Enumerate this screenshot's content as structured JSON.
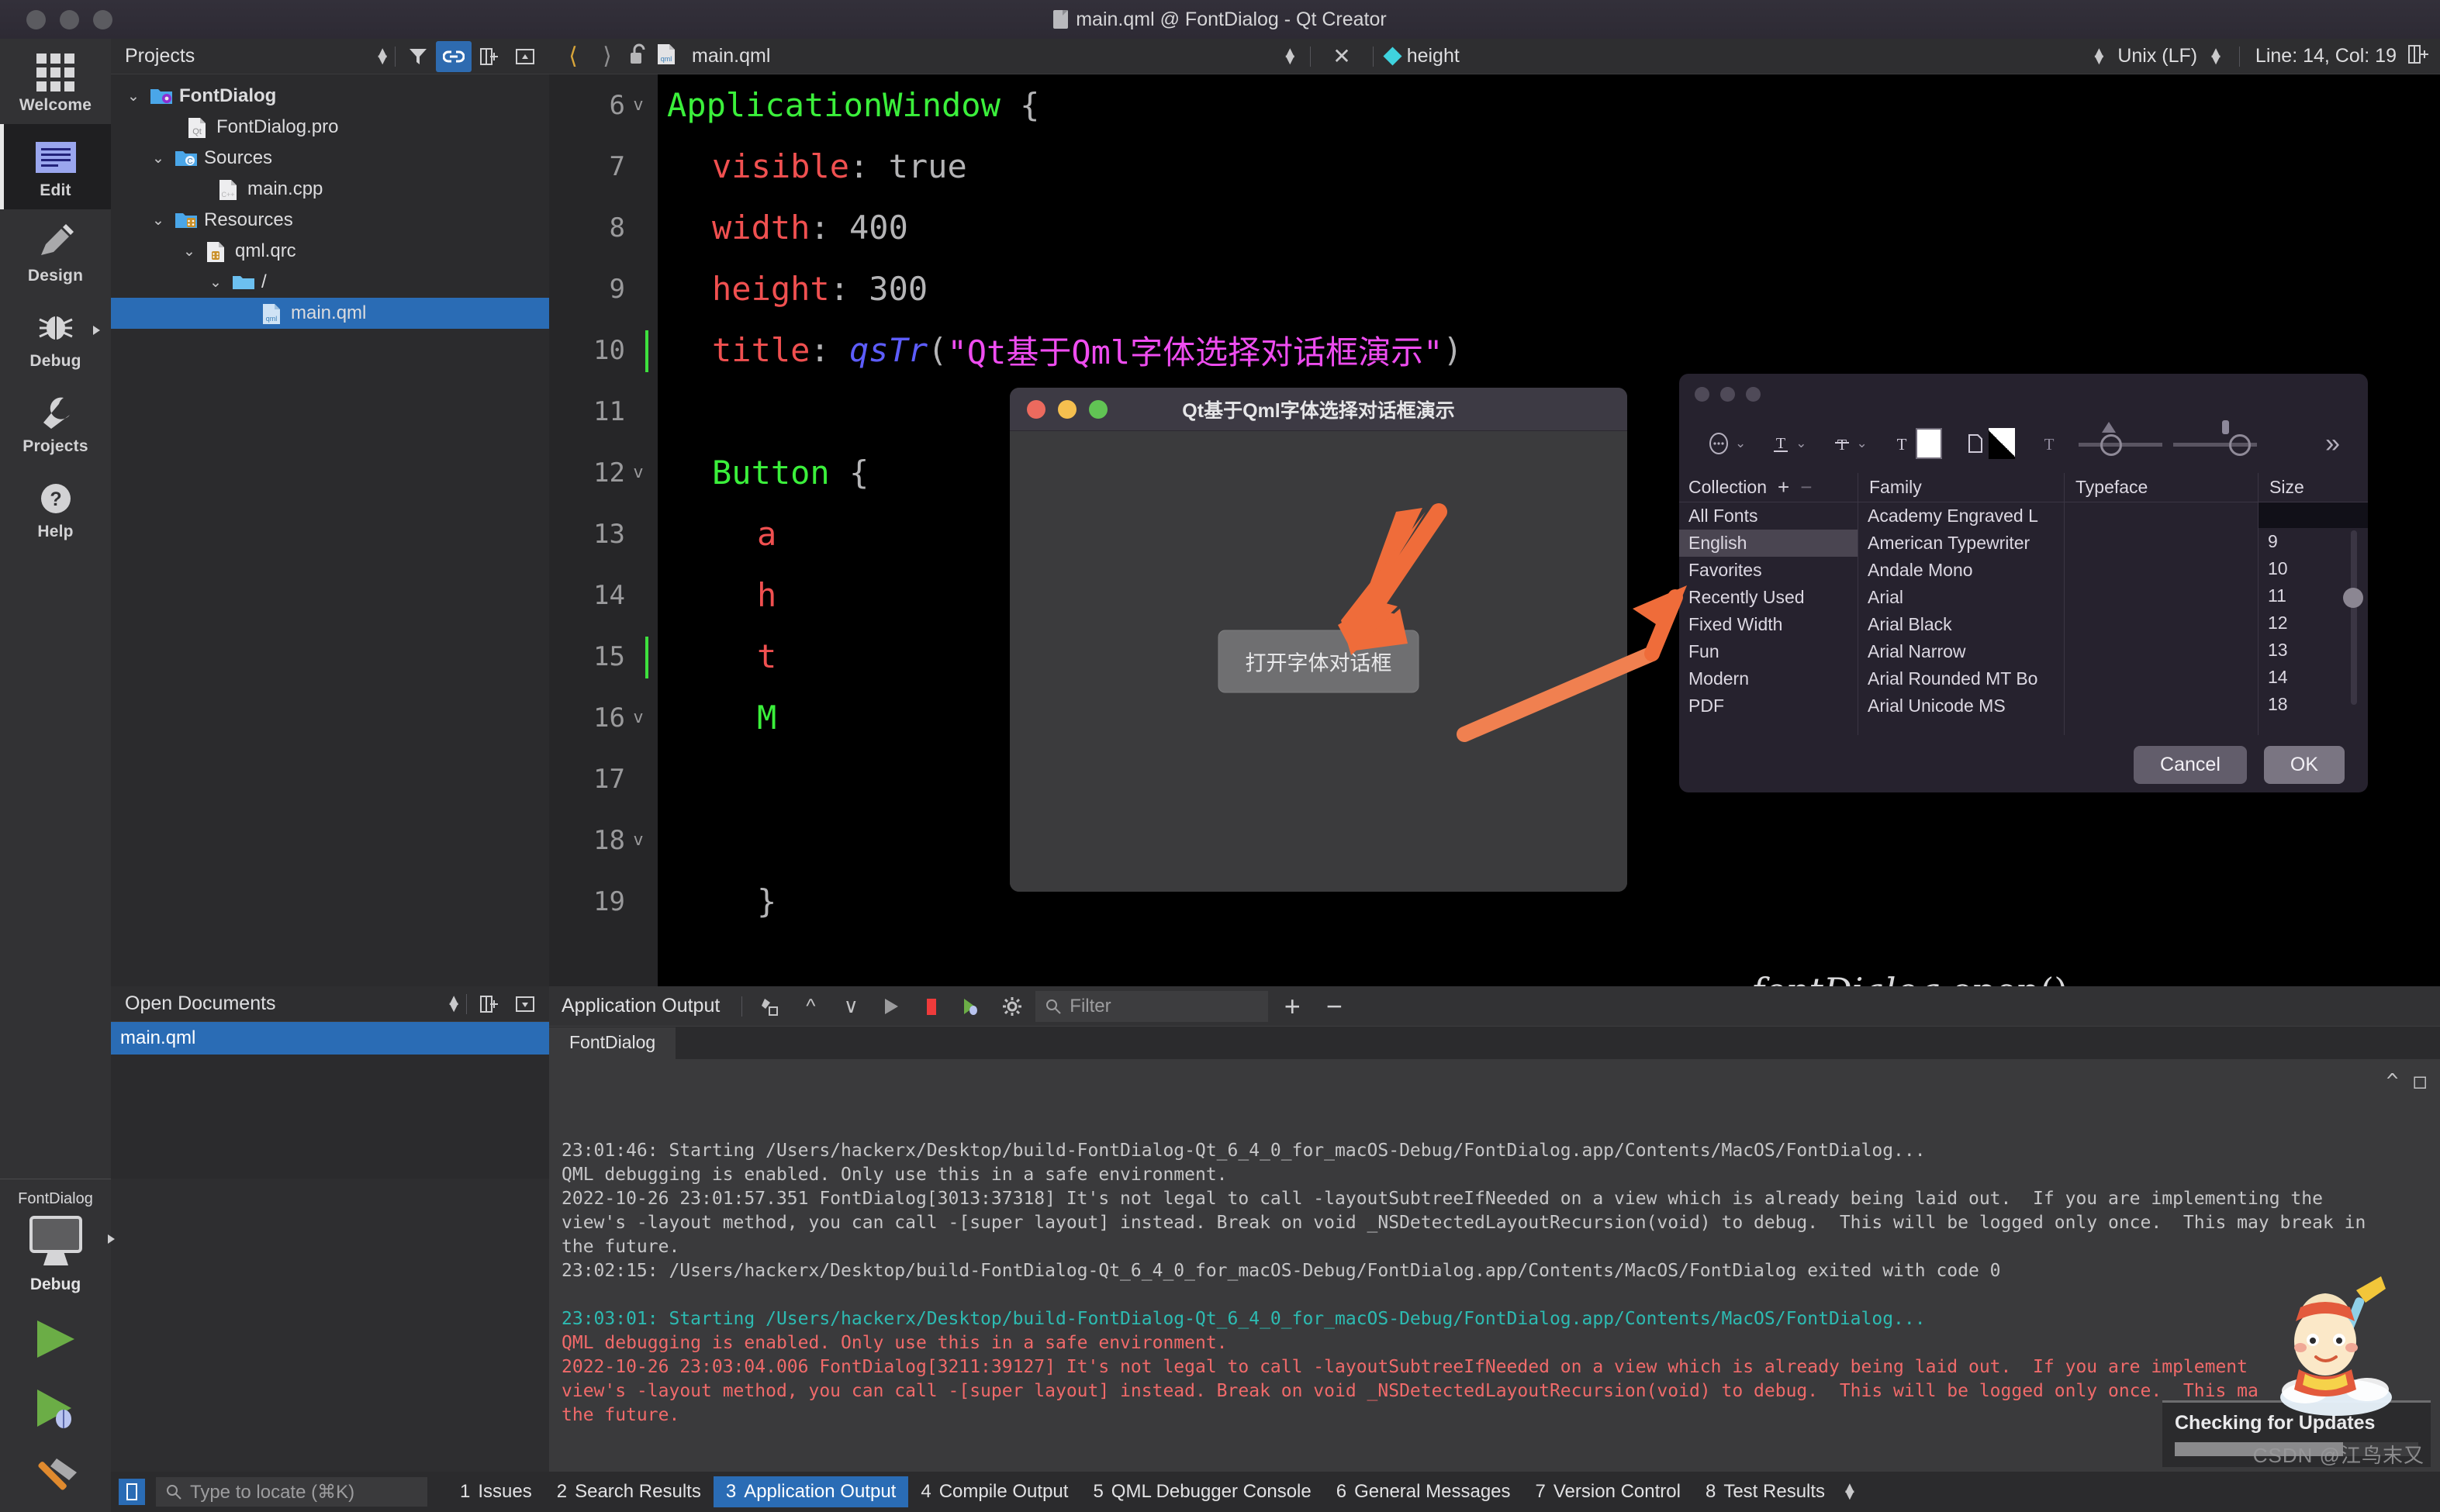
{
  "window": {
    "title": "main.qml @ FontDialog - Qt Creator"
  },
  "modebar": {
    "items": [
      {
        "label": "Welcome",
        "icon": "grid-icon"
      },
      {
        "label": "Edit",
        "icon": "edit-icon"
      },
      {
        "label": "Design",
        "icon": "pencil-icon"
      },
      {
        "label": "Debug",
        "icon": "bug-icon"
      },
      {
        "label": "Projects",
        "icon": "wrench-icon"
      },
      {
        "label": "Help",
        "icon": "question-icon"
      }
    ]
  },
  "kit": {
    "project": "FontDialog",
    "config": "Debug",
    "run_label": "Run",
    "debug_label": "Start Debugging",
    "build_label": "Build"
  },
  "projects_panel": {
    "title": "Projects",
    "tree": [
      {
        "label": "FontDialog",
        "indent": 0,
        "chevron": "v",
        "icon": "project-folder-icon",
        "bold": true,
        "selected": false
      },
      {
        "label": "FontDialog.pro",
        "indent": 1,
        "chevron": "",
        "icon": "qt-pro-file-icon",
        "bold": false,
        "selected": false
      },
      {
        "label": "Sources",
        "indent": 1,
        "chevron": "v",
        "icon": "sources-folder-icon",
        "bold": false,
        "selected": false
      },
      {
        "label": "main.cpp",
        "indent": 2,
        "chevron": "",
        "icon": "cpp-file-icon",
        "bold": false,
        "selected": false
      },
      {
        "label": "Resources",
        "indent": 1,
        "chevron": "v",
        "icon": "resources-folder-icon",
        "bold": false,
        "selected": false
      },
      {
        "label": "qml.qrc",
        "indent": 2,
        "chevron": "v",
        "icon": "qrc-file-icon",
        "bold": false,
        "selected": false
      },
      {
        "label": "/",
        "indent": 3,
        "chevron": "v",
        "icon": "plain-folder-icon",
        "bold": false,
        "selected": false
      },
      {
        "label": "main.qml",
        "indent": 4,
        "chevron": "",
        "icon": "qml-file-icon",
        "bold": false,
        "selected": true
      }
    ]
  },
  "open_documents": {
    "title": "Open Documents",
    "items": [
      {
        "label": "main.qml",
        "selected": true
      }
    ]
  },
  "editor_toolbar": {
    "back_icon": "chevron-left-icon",
    "forward_icon": "chevron-right-icon",
    "lock_icon": "unlocked-icon",
    "filename": "main.qml",
    "close_icon": "close-x-icon",
    "symbol": "height",
    "line_ending": "Unix (LF)",
    "cursor_position": "Line: 14, Col: 19",
    "split_icon": "split-editor-icon"
  },
  "code": {
    "lines": [
      {
        "num": "6",
        "fold": "v",
        "indent": 0,
        "tokens": [
          {
            "t": "ApplicationWindow ",
            "c": "k-type"
          },
          {
            "t": "{",
            "c": "k-punc"
          }
        ]
      },
      {
        "num": "7",
        "fold": "",
        "indent": 1,
        "tokens": [
          {
            "t": "visible",
            "c": "k-prop"
          },
          {
            "t": ": ",
            "c": "k-punc"
          },
          {
            "t": "true",
            "c": "k-val"
          }
        ]
      },
      {
        "num": "8",
        "fold": "",
        "indent": 1,
        "tokens": [
          {
            "t": "width",
            "c": "k-prop"
          },
          {
            "t": ": ",
            "c": "k-punc"
          },
          {
            "t": "400",
            "c": "k-val"
          }
        ]
      },
      {
        "num": "9",
        "fold": "",
        "indent": 1,
        "tokens": [
          {
            "t": "height",
            "c": "k-prop"
          },
          {
            "t": ": ",
            "c": "k-punc"
          },
          {
            "t": "300",
            "c": "k-val"
          }
        ]
      },
      {
        "num": "10",
        "fold": "",
        "indent": 1,
        "tokens": [
          {
            "t": "title",
            "c": "k-prop"
          },
          {
            "t": ": ",
            "c": "k-punc"
          },
          {
            "t": "qsTr",
            "c": "k-fn"
          },
          {
            "t": "(",
            "c": "k-punc"
          },
          {
            "t": "\"Qt基于Qml字体选择对话框演示\"",
            "c": "k-str"
          },
          {
            "t": ")",
            "c": "k-punc"
          }
        ]
      },
      {
        "num": "11",
        "fold": "",
        "indent": 0,
        "tokens": []
      },
      {
        "num": "12",
        "fold": "v",
        "indent": 1,
        "tokens": [
          {
            "t": "Button",
            "c": "k-type"
          },
          {
            "t": " {",
            "c": "k-punc"
          }
        ]
      },
      {
        "num": "13",
        "fold": "",
        "indent": 2,
        "tokens": [
          {
            "t": "a",
            "c": "k-prop"
          }
        ]
      },
      {
        "num": "14",
        "fold": "",
        "indent": 2,
        "tokens": [
          {
            "t": "h",
            "c": "k-prop"
          }
        ]
      },
      {
        "num": "15",
        "fold": "",
        "indent": 2,
        "tokens": [
          {
            "t": "t",
            "c": "k-prop"
          }
        ]
      },
      {
        "num": "16",
        "fold": "v",
        "indent": 2,
        "tokens": [
          {
            "t": "M",
            "c": "k-type"
          }
        ]
      },
      {
        "num": "17",
        "fold": "",
        "indent": 0,
        "tokens": []
      },
      {
        "num": "18",
        "fold": "v",
        "indent": 0,
        "tokens": []
      },
      {
        "num": "19",
        "fold": "",
        "indent": 2,
        "tokens": [
          {
            "t": "}",
            "c": "k-punc"
          }
        ]
      }
    ],
    "overlay_text_italic": "fontDialog",
    "overlay_text_plain": ".open()"
  },
  "qt_window": {
    "title": "Qt基于Qml字体选择对话框演示",
    "button_label": "打开字体对话框",
    "traffic_colors": [
      "#ec6a5e",
      "#f5bf4f",
      "#61c454"
    ]
  },
  "font_panel": {
    "columns": {
      "collection": "Collection",
      "family": "Family",
      "typeface": "Typeface",
      "size": "Size",
      "add_icon": "plus-icon",
      "remove_icon": "minus-icon"
    },
    "toolbar_icons": [
      "actions-menu-icon",
      "text-underline-icon",
      "text-strikethrough-icon",
      "text-color-icon",
      "page-color-icon",
      "text-shadow-icon",
      "shadow-blur-slider",
      "shadow-offset-slider",
      "overflow-chevrons-icon"
    ],
    "collections": [
      "All Fonts",
      "English",
      "Favorites",
      "Recently Used",
      "Fixed Width",
      "Fun",
      "Modern",
      "PDF"
    ],
    "selected_collection": "English",
    "families": [
      "Academy Engraved L",
      "American Typewriter",
      "Andale Mono",
      "Arial",
      "Arial Black",
      "Arial Narrow",
      "Arial Rounded MT Bo",
      "Arial Unicode MS"
    ],
    "typefaces": [],
    "sizes": [
      "9",
      "10",
      "11",
      "12",
      "13",
      "14",
      "18"
    ],
    "cancel_label": "Cancel",
    "ok_label": "OK"
  },
  "output_pane": {
    "title": "Application Output",
    "icons": [
      "clear-output-icon",
      "prev-item-icon",
      "next-item-icon",
      "run-icon",
      "stop-icon",
      "attach-debugger-icon",
      "settings-gear-icon",
      "search-icon",
      "add-icon",
      "remove-icon"
    ],
    "filter_placeholder": "Filter",
    "tab": "FontDialog",
    "log": [
      {
        "text": "23:01:46: Starting /Users/hackerx/Desktop/build-FontDialog-Qt_6_4_0_for_macOS-Debug/FontDialog.app/Contents/MacOS/FontDialog...",
        "color": "gray"
      },
      {
        "text": "QML debugging is enabled. Only use this in a safe environment.",
        "color": "gray"
      },
      {
        "text": "2022-10-26 23:01:57.351 FontDialog[3013:37318] It's not legal to call -layoutSubtreeIfNeeded on a view which is already being laid out.  If you are implementing the",
        "color": "gray"
      },
      {
        "text": "view's -layout method, you can call -[super layout] instead. Break on void _NSDetectedLayoutRecursion(void) to debug.  This will be logged only once.  This may break in",
        "color": "gray"
      },
      {
        "text": "the future.",
        "color": "gray"
      },
      {
        "text": "23:02:15: /Users/hackerx/Desktop/build-FontDialog-Qt_6_4_0_for_macOS-Debug/FontDialog.app/Contents/MacOS/FontDialog exited with code 0",
        "color": "gray"
      },
      {
        "text": "",
        "color": "gray"
      },
      {
        "text": "23:03:01: Starting /Users/hackerx/Desktop/build-FontDialog-Qt_6_4_0_for_macOS-Debug/FontDialog.app/Contents/MacOS/FontDialog...",
        "color": "teal"
      },
      {
        "text": "QML debugging is enabled. Only use this in a safe environment.",
        "color": "red"
      },
      {
        "text": "2022-10-26 23:03:04.006 FontDialog[3211:39127] It's not legal to call -layoutSubtreeIfNeeded on a view which is already being laid out.  If you are implement",
        "color": "red"
      },
      {
        "text": "view's -layout method, you can call -[super layout] instead. Break on void _NSDetectedLayoutRecursion(void) to debug.  This will be logged only once.  This ma    in",
        "color": "red"
      },
      {
        "text": "the future.",
        "color": "red"
      }
    ]
  },
  "updates_popup": {
    "title": "Checking for Updates",
    "progress_percent": 69
  },
  "status_bar": {
    "sidebar_toggle_icon": "sidebar-toggle-icon",
    "locate_icon": "search-icon",
    "locate_placeholder": "Type to locate (⌘K)",
    "tabs": [
      {
        "num": "1",
        "label": "Issues",
        "active": false
      },
      {
        "num": "2",
        "label": "Search Results",
        "active": false
      },
      {
        "num": "3",
        "label": "Application Output",
        "active": true
      },
      {
        "num": "4",
        "label": "Compile Output",
        "active": false
      },
      {
        "num": "5",
        "label": "QML Debugger Console",
        "active": false
      },
      {
        "num": "6",
        "label": "General Messages",
        "active": false
      },
      {
        "num": "7",
        "label": "Version Control",
        "active": false
      },
      {
        "num": "8",
        "label": "Test Results",
        "active": false
      }
    ]
  },
  "watermark": {
    "text": "CSDN @江鸟末又"
  },
  "colors": {
    "accent_blue": "#2a6cb5",
    "arrow_orange": "#ef6c3a",
    "code_green": "#3bf03b",
    "code_red": "#f05050",
    "code_magenta": "#ef4df0",
    "log_teal": "#2dbbb2",
    "log_red": "#f06a6a"
  }
}
